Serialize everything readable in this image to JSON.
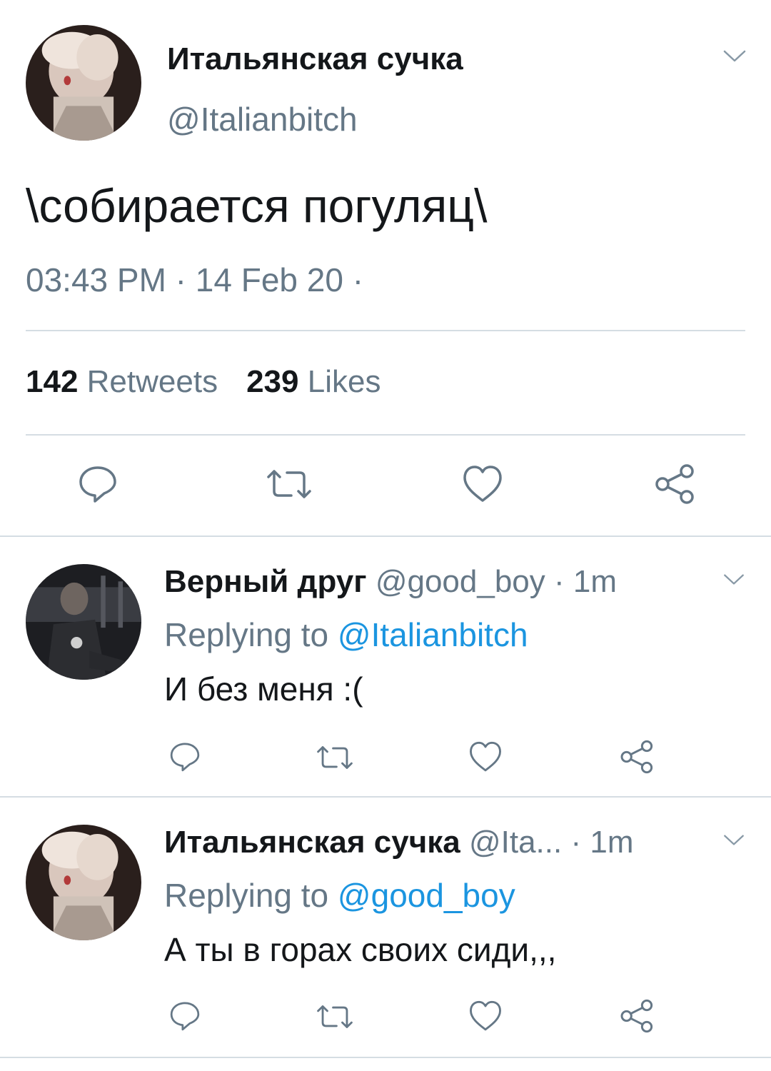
{
  "main_tweet": {
    "author_name": "Итальянская сучка",
    "author_handle": "@Italianbitch",
    "text": "\\собирается погуляц\\",
    "timestamp": "03:43 PM · 14 Feb 20 ·",
    "retweets_count": "142",
    "retweets_label": "Retweets",
    "likes_count": "239",
    "likes_label": "Likes"
  },
  "replies": [
    {
      "author_name": "Верный друг",
      "author_handle": "@good_boy",
      "time": "· 1m",
      "replying_prefix": "Replying to",
      "replying_to": "@Italianbitch",
      "text": "И без меня :("
    },
    {
      "author_name": "Итальянская сучка",
      "author_handle": "@Ita...",
      "time": "· 1m",
      "replying_prefix": "Replying to",
      "replying_to": "@good_boy",
      "text": "А ты в горах своих сиди,,,"
    }
  ],
  "icons": {
    "reply": "reply-icon",
    "retweet": "retweet-icon",
    "like": "heart-icon",
    "share": "share-icon",
    "more": "chevron-down-icon"
  },
  "colors": {
    "text": "#14171a",
    "secondary": "#657786",
    "link": "#1b95e0",
    "divider": "#d5dde3"
  }
}
